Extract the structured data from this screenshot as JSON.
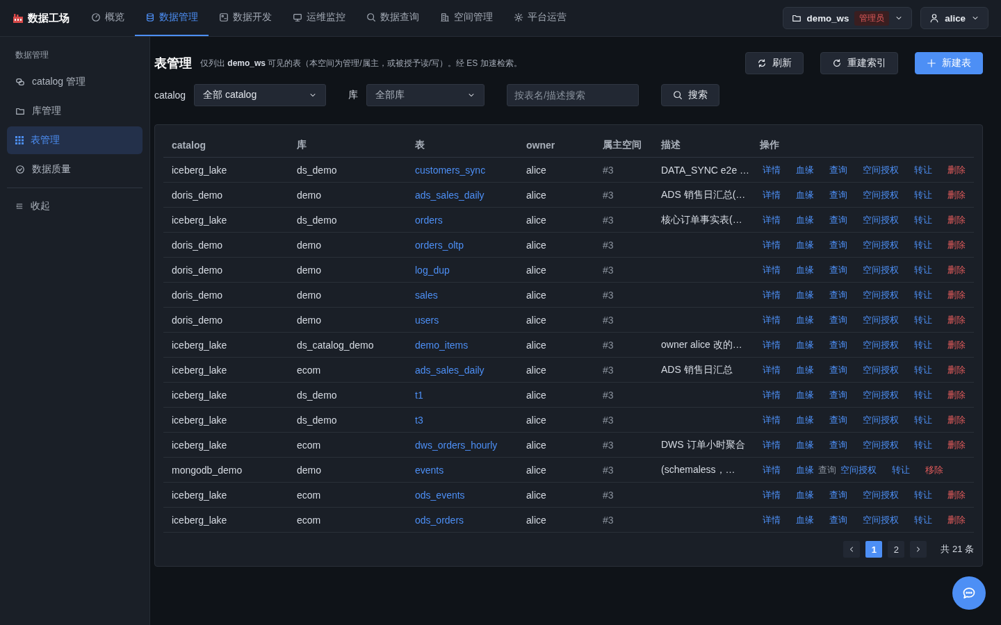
{
  "topbar": {
    "logo": "数据工场",
    "nav": [
      {
        "label": "概览",
        "kind": "gauge",
        "selected": false
      },
      {
        "label": "数据管理",
        "kind": "database",
        "selected": true
      },
      {
        "label": "数据开发",
        "kind": "code",
        "selected": false
      },
      {
        "label": "运维监控",
        "kind": "monitor",
        "selected": false
      },
      {
        "label": "数据查询",
        "kind": "search",
        "selected": false
      },
      {
        "label": "空间管理",
        "kind": "building",
        "selected": false
      },
      {
        "label": "平台运营",
        "kind": "gear",
        "selected": false
      }
    ],
    "workspace": {
      "name": "demo_ws",
      "role": "管理员"
    },
    "user": "alice"
  },
  "sidebar": {
    "heading": "数据管理",
    "items": [
      {
        "label": "catalog 管理",
        "kind": "link",
        "selected": false
      },
      {
        "label": "库管理",
        "kind": "folder",
        "selected": false
      },
      {
        "label": "表管理",
        "kind": "grid",
        "selected": true
      },
      {
        "label": "数据质量",
        "kind": "check",
        "selected": false
      }
    ],
    "collapse": "收起"
  },
  "page": {
    "title": "表管理",
    "subtitle": "仅列出 **demo_ws** 可见的表（本空间为管理/属主，或被授予读/写）。经 ES 加速检索。",
    "buttons": [
      {
        "label": "刷新",
        "kind": "refresh"
      },
      {
        "label": "重建索引",
        "kind": "rebuild"
      },
      {
        "label": "新建表",
        "kind": "primary"
      }
    ]
  },
  "filters": {
    "catalog_label": "catalog",
    "catalog_value": "全部 catalog",
    "db_label": "库",
    "db_value": "全部库",
    "search_placeholder": "按表名/描述搜索",
    "search_button": "搜索"
  },
  "table": {
    "columns": [
      "catalog",
      "库",
      "表",
      "owner",
      "属主空间",
      "描述",
      "操作"
    ],
    "rows": [
      {
        "catalog": "iceberg_lake",
        "db": "ds_demo",
        "table": "customers_sync",
        "owner": "alice",
        "space": "#3",
        "desc": "DATA_SYNC e2e …",
        "actions": [
          {
            "label": "详情",
            "kind": "link",
            "disabled": false
          },
          {
            "label": "血缘",
            "kind": "link",
            "disabled": false
          },
          {
            "label": "查询",
            "kind": "link",
            "disabled": false
          },
          {
            "label": "空间授权",
            "kind": "link",
            "disabled": false
          },
          {
            "label": "转让",
            "kind": "link",
            "disabled": false
          },
          {
            "label": "删除",
            "kind": "danger",
            "disabled": false
          }
        ]
      },
      {
        "catalog": "doris_demo",
        "db": "demo",
        "table": "ads_sales_daily",
        "owner": "alice",
        "space": "#3",
        "desc": "ADS 销售日汇总(…",
        "actions": [
          {
            "label": "详情",
            "kind": "link",
            "disabled": false
          },
          {
            "label": "血缘",
            "kind": "link",
            "disabled": false
          },
          {
            "label": "查询",
            "kind": "link",
            "disabled": false
          },
          {
            "label": "空间授权",
            "kind": "link",
            "disabled": false
          },
          {
            "label": "转让",
            "kind": "link",
            "disabled": false
          },
          {
            "label": "删除",
            "kind": "danger",
            "disabled": false
          }
        ]
      },
      {
        "catalog": "iceberg_lake",
        "db": "ds_demo",
        "table": "orders",
        "owner": "alice",
        "space": "#3",
        "desc": "核心订单事实表(…",
        "actions": [
          {
            "label": "详情",
            "kind": "link",
            "disabled": false
          },
          {
            "label": "血缘",
            "kind": "link",
            "disabled": false
          },
          {
            "label": "查询",
            "kind": "link",
            "disabled": false
          },
          {
            "label": "空间授权",
            "kind": "link",
            "disabled": false
          },
          {
            "label": "转让",
            "kind": "link",
            "disabled": false
          },
          {
            "label": "删除",
            "kind": "danger",
            "disabled": false
          }
        ]
      },
      {
        "catalog": "doris_demo",
        "db": "demo",
        "table": "orders_oltp",
        "owner": "alice",
        "space": "#3",
        "actions": [
          {
            "label": "详情",
            "kind": "link",
            "disabled": false
          },
          {
            "label": "血缘",
            "kind": "link",
            "disabled": false
          },
          {
            "label": "查询",
            "kind": "link",
            "disabled": false
          },
          {
            "label": "空间授权",
            "kind": "link",
            "disabled": false
          },
          {
            "label": "转让",
            "kind": "link",
            "disabled": false
          },
          {
            "label": "删除",
            "kind": "danger",
            "disabled": false
          }
        ]
      },
      {
        "catalog": "doris_demo",
        "db": "demo",
        "table": "log_dup",
        "owner": "alice",
        "space": "#3",
        "actions": [
          {
            "label": "详情",
            "kind": "link",
            "disabled": false
          },
          {
            "label": "血缘",
            "kind": "link",
            "disabled": false
          },
          {
            "label": "查询",
            "kind": "link",
            "disabled": false
          },
          {
            "label": "空间授权",
            "kind": "link",
            "disabled": false
          },
          {
            "label": "转让",
            "kind": "link",
            "disabled": false
          },
          {
            "label": "删除",
            "kind": "danger",
            "disabled": false
          }
        ]
      },
      {
        "catalog": "doris_demo",
        "db": "demo",
        "table": "sales",
        "owner": "alice",
        "space": "#3",
        "actions": [
          {
            "label": "详情",
            "kind": "link",
            "disabled": false
          },
          {
            "label": "血缘",
            "kind": "link",
            "disabled": false
          },
          {
            "label": "查询",
            "kind": "link",
            "disabled": false
          },
          {
            "label": "空间授权",
            "kind": "link",
            "disabled": false
          },
          {
            "label": "转让",
            "kind": "link",
            "disabled": false
          },
          {
            "label": "删除",
            "kind": "danger",
            "disabled": false
          }
        ]
      },
      {
        "catalog": "doris_demo",
        "db": "demo",
        "table": "users",
        "owner": "alice",
        "space": "#3",
        "actions": [
          {
            "label": "详情",
            "kind": "link",
            "disabled": false
          },
          {
            "label": "血缘",
            "kind": "link",
            "disabled": false
          },
          {
            "label": "查询",
            "kind": "link",
            "disabled": false
          },
          {
            "label": "空间授权",
            "kind": "link",
            "disabled": false
          },
          {
            "label": "转让",
            "kind": "link",
            "disabled": false
          },
          {
            "label": "删除",
            "kind": "danger",
            "disabled": false
          }
        ]
      },
      {
        "catalog": "iceberg_lake",
        "db": "ds_catalog_demo",
        "table": "demo_items",
        "owner": "alice",
        "space": "#3",
        "desc": "owner alice 改的…",
        "actions": [
          {
            "label": "详情",
            "kind": "link",
            "disabled": false
          },
          {
            "label": "血缘",
            "kind": "link",
            "disabled": false
          },
          {
            "label": "查询",
            "kind": "link",
            "disabled": false
          },
          {
            "label": "空间授权",
            "kind": "link",
            "disabled": false
          },
          {
            "label": "转让",
            "kind": "link",
            "disabled": false
          },
          {
            "label": "删除",
            "kind": "danger",
            "disabled": false
          }
        ]
      },
      {
        "catalog": "iceberg_lake",
        "db": "ecom",
        "table": "ads_sales_daily",
        "owner": "alice",
        "space": "#3",
        "desc": "ADS 销售日汇总",
        "actions": [
          {
            "label": "详情",
            "kind": "link",
            "disabled": false
          },
          {
            "label": "血缘",
            "kind": "link",
            "disabled": false
          },
          {
            "label": "查询",
            "kind": "link",
            "disabled": false
          },
          {
            "label": "空间授权",
            "kind": "link",
            "disabled": false
          },
          {
            "label": "转让",
            "kind": "link",
            "disabled": false
          },
          {
            "label": "删除",
            "kind": "danger",
            "disabled": false
          }
        ]
      },
      {
        "catalog": "iceberg_lake",
        "db": "ds_demo",
        "table": "t1",
        "owner": "alice",
        "space": "#3",
        "actions": [
          {
            "label": "详情",
            "kind": "link",
            "disabled": false
          },
          {
            "label": "血缘",
            "kind": "link",
            "disabled": false
          },
          {
            "label": "查询",
            "kind": "link",
            "disabled": false
          },
          {
            "label": "空间授权",
            "kind": "link",
            "disabled": false
          },
          {
            "label": "转让",
            "kind": "link",
            "disabled": false
          },
          {
            "label": "删除",
            "kind": "danger",
            "disabled": false
          }
        ]
      },
      {
        "catalog": "iceberg_lake",
        "db": "ds_demo",
        "table": "t3",
        "owner": "alice",
        "space": "#3",
        "actions": [
          {
            "label": "详情",
            "kind": "link",
            "disabled": false
          },
          {
            "label": "血缘",
            "kind": "link",
            "disabled": false
          },
          {
            "label": "查询",
            "kind": "link",
            "disabled": false
          },
          {
            "label": "空间授权",
            "kind": "link",
            "disabled": false
          },
          {
            "label": "转让",
            "kind": "link",
            "disabled": false
          },
          {
            "label": "删除",
            "kind": "danger",
            "disabled": false
          }
        ]
      },
      {
        "catalog": "iceberg_lake",
        "db": "ecom",
        "table": "dws_orders_hourly",
        "owner": "alice",
        "space": "#3",
        "desc": "DWS 订单小时聚合",
        "actions": [
          {
            "label": "详情",
            "kind": "link",
            "disabled": false
          },
          {
            "label": "血缘",
            "kind": "link",
            "disabled": false
          },
          {
            "label": "查询",
            "kind": "link",
            "disabled": false
          },
          {
            "label": "空间授权",
            "kind": "link",
            "disabled": false
          },
          {
            "label": "转让",
            "kind": "link",
            "disabled": false
          },
          {
            "label": "删除",
            "kind": "danger",
            "disabled": false
          }
        ]
      },
      {
        "catalog": "mongodb_demo",
        "db": "demo",
        "table": "events",
        "owner": "alice",
        "space": "#3",
        "desc": "(schemaless，…",
        "actions": [
          {
            "label": "详情",
            "kind": "link",
            "disabled": false
          },
          {
            "label": "血缘",
            "kind": "link",
            "disabled": false
          },
          {
            "label": "查询",
            "kind": "link",
            "disabled": true
          },
          {
            "label": "空间授权",
            "kind": "link",
            "disabled": false
          },
          {
            "label": "转让",
            "kind": "link",
            "disabled": false
          },
          {
            "label": "移除",
            "kind": "danger",
            "disabled": false
          }
        ]
      },
      {
        "catalog": "iceberg_lake",
        "db": "ecom",
        "table": "ods_events",
        "owner": "alice",
        "space": "#3",
        "actions": [
          {
            "label": "详情",
            "kind": "link",
            "disabled": false
          },
          {
            "label": "血缘",
            "kind": "link",
            "disabled": false
          },
          {
            "label": "查询",
            "kind": "link",
            "disabled": false
          },
          {
            "label": "空间授权",
            "kind": "link",
            "disabled": false
          },
          {
            "label": "转让",
            "kind": "link",
            "disabled": false
          },
          {
            "label": "删除",
            "kind": "danger",
            "disabled": false
          }
        ]
      },
      {
        "catalog": "iceberg_lake",
        "db": "ecom",
        "table": "ods_orders",
        "owner": "alice",
        "space": "#3",
        "actions": [
          {
            "label": "详情",
            "kind": "link",
            "disabled": false
          },
          {
            "label": "血缘",
            "kind": "link",
            "disabled": false
          },
          {
            "label": "查询",
            "kind": "link",
            "disabled": false
          },
          {
            "label": "空间授权",
            "kind": "link",
            "disabled": false
          },
          {
            "label": "转让",
            "kind": "link",
            "disabled": false
          },
          {
            "label": "删除",
            "kind": "danger",
            "disabled": false
          }
        ]
      }
    ]
  },
  "pagination": {
    "pages": [
      {
        "label": "1",
        "selected": true
      },
      {
        "label": "2",
        "selected": false
      }
    ],
    "total": "共 21 条"
  }
}
